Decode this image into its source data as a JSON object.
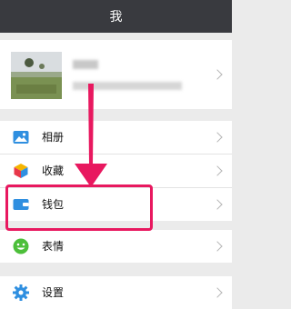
{
  "header": {
    "title": "我"
  },
  "menu": {
    "album": "相册",
    "favorites": "收藏",
    "wallet": "钱包",
    "stickers": "表情",
    "settings": "设置"
  },
  "colors": {
    "titlebar": "#393a3f",
    "highlight": "#e8185f",
    "background": "#ebebeb"
  },
  "icons": {
    "album": "image-icon",
    "favorites": "cube-icon",
    "wallet": "wallet-icon",
    "stickers": "smiley-icon",
    "settings": "gear-icon"
  }
}
